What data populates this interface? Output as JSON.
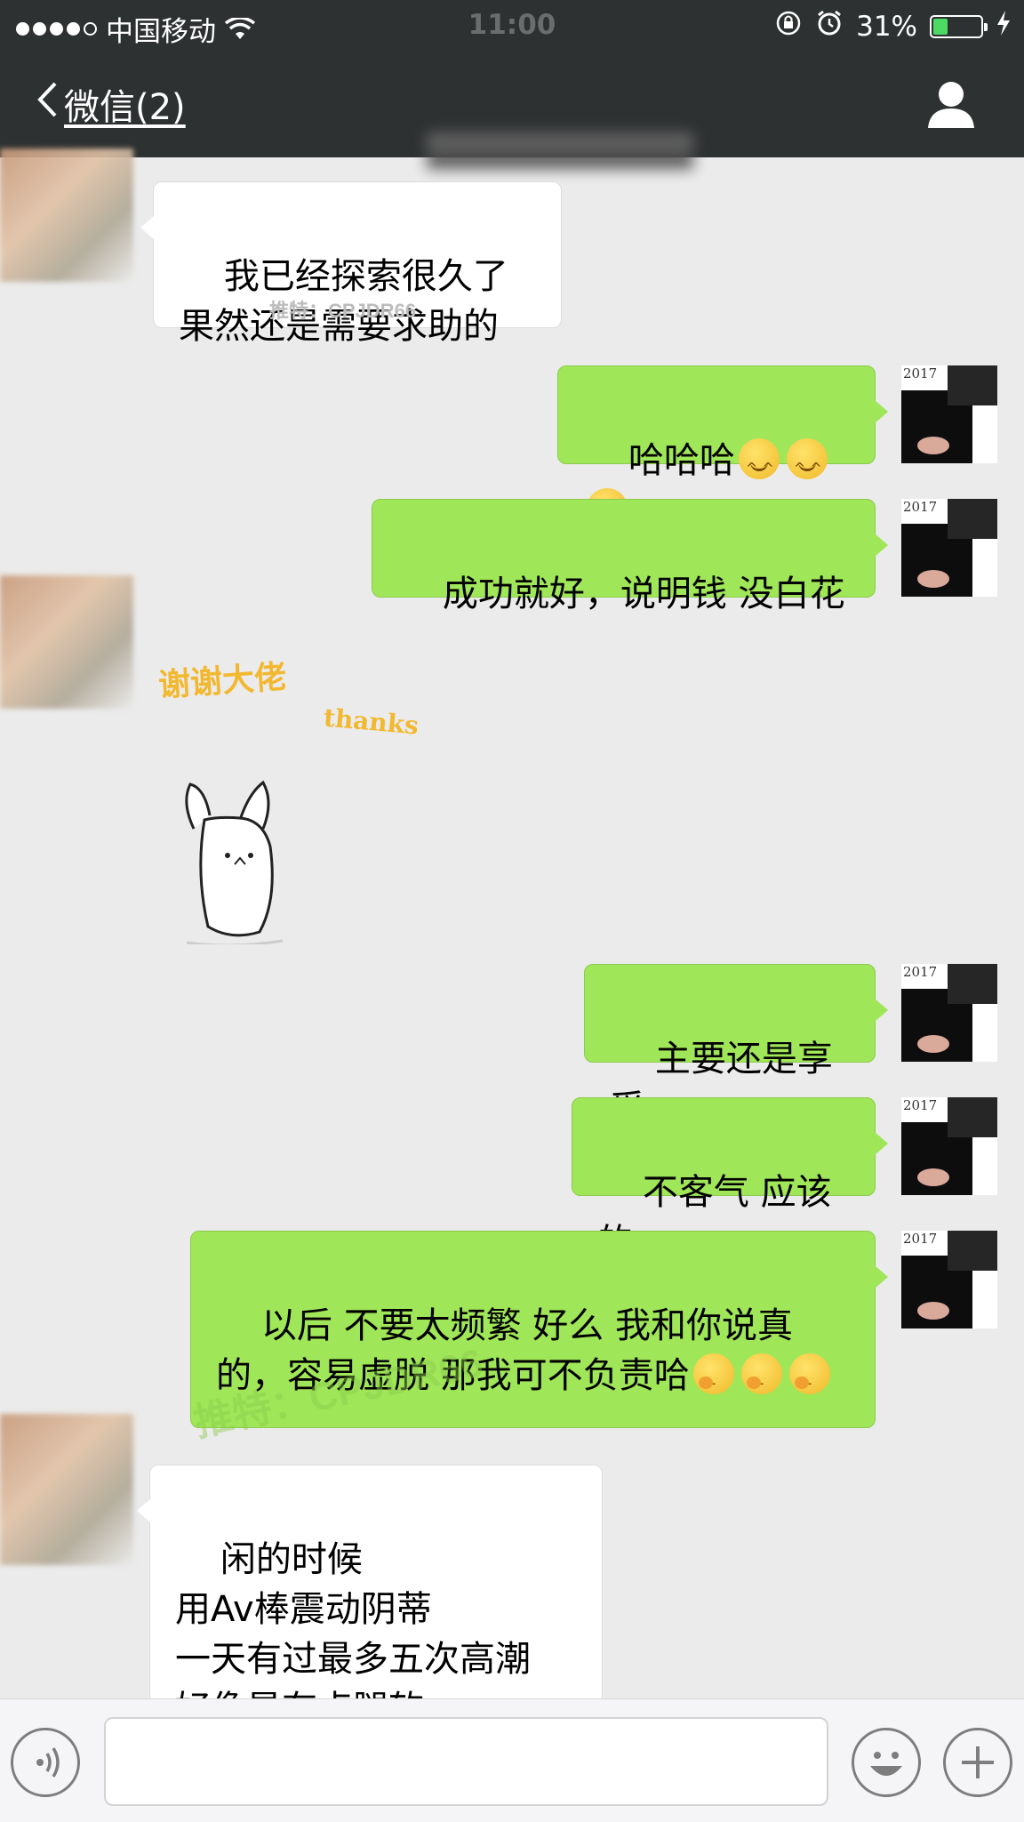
{
  "status_bar": {
    "carrier": "中国移动",
    "time": "11:00",
    "battery_percent": "31%",
    "battery_level": 0.31,
    "icons": [
      "signal-icon",
      "wifi-icon",
      "orientation-lock-icon",
      "alarm-icon",
      "battery-icon",
      "charging-icon"
    ]
  },
  "nav": {
    "back_label": "微信(2)",
    "contact_icon": "person-icon"
  },
  "messages": [
    {
      "from": "them",
      "text": "我已经探索很久了\n果然还是需要求助的"
    },
    {
      "from": "me",
      "text": "哈哈哈",
      "emoji": [
        "smile",
        "smile",
        "smile"
      ]
    },
    {
      "from": "me",
      "text": "成功就好，说明钱 没白花"
    },
    {
      "from": "them",
      "type": "sticker",
      "sticker_text": [
        "谢谢大佬",
        "thanks"
      ]
    },
    {
      "from": "me",
      "text": "主要还是享受"
    },
    {
      "from": "me",
      "text": "不客气 应该的"
    },
    {
      "from": "me",
      "text": "以后 不要太频繁 好么 我和你说真的，容易虚脱 那我可不负责哈",
      "emoji": [
        "thinking",
        "thinking",
        "thinking"
      ]
    },
    {
      "from": "them",
      "text": "闲的时候\n用Av棒震动阴蒂\n一天有过最多五次高潮\n好像是有点腿软"
    }
  ],
  "avatar_me_caption": "2017",
  "watermarks": [
    "推特：CPJDR66",
    "推特：CPJDR66"
  ],
  "input_bar": {
    "placeholder": "",
    "icons": [
      "voice-icon",
      "emoji-icon",
      "plus-icon"
    ]
  }
}
